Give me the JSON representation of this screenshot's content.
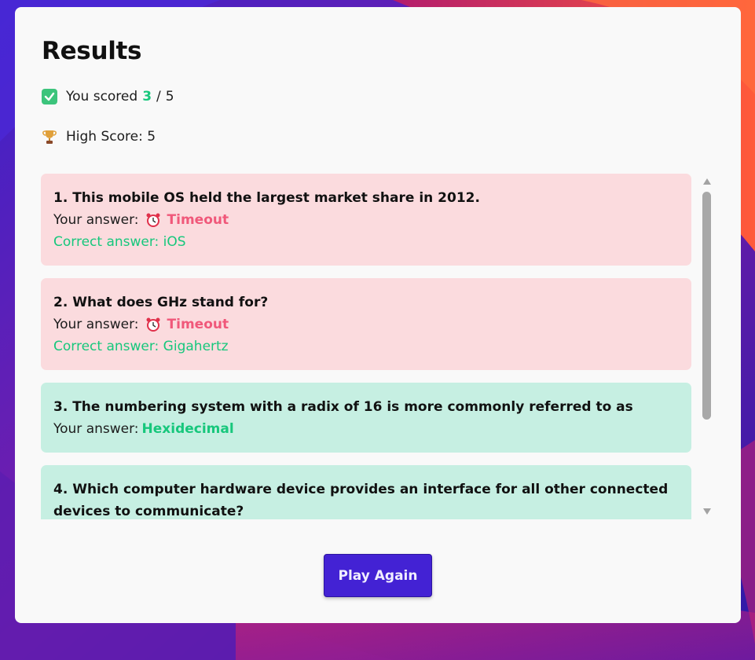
{
  "results": {
    "title": "Results",
    "score_prefix": "You scored",
    "score_value": "3",
    "score_separator": "/",
    "score_total": "5",
    "high_score_label": "High Score: 5",
    "icons": {
      "score": "check-icon",
      "high_score": "trophy-icon",
      "timeout": "alarm-clock-icon"
    }
  },
  "answer_label": "Your answer:",
  "items": [
    {
      "question": "1. This mobile OS held the largest market share in 2012.",
      "status": "wrong",
      "your_answer": "Timeout",
      "correct_answer": "Correct answer: iOS"
    },
    {
      "question": "2. What does GHz stand for?",
      "status": "wrong",
      "your_answer": "Timeout",
      "correct_answer": "Correct answer: Gigahertz"
    },
    {
      "question": "3. The numbering system with a radix of 16 is more commonly referred to as",
      "status": "right",
      "your_answer": "Hexidecimal"
    },
    {
      "question": "4. Which computer hardware device provides an interface for all other connected devices to communicate?",
      "status": "right"
    }
  ],
  "play_again_label": "Play Again",
  "colors": {
    "wrong_bg": "#fbdbde",
    "right_bg": "#c6efe2",
    "correct_green": "#17c77c",
    "timeout_red": "#f0587a",
    "button": "#4322d4"
  }
}
